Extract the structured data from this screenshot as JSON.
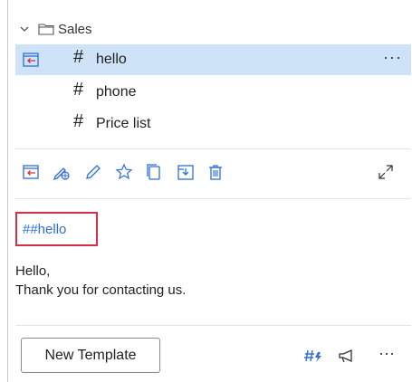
{
  "folder": {
    "name": "Sales"
  },
  "templates": [
    {
      "hash": "#",
      "label": "hello"
    },
    {
      "hash": "#",
      "label": "phone"
    },
    {
      "hash": "#",
      "label": "Price list"
    }
  ],
  "selected_more": "···",
  "preview": {
    "name": "##hello",
    "body": [
      "Hello,",
      "Thank you for contacting us."
    ]
  },
  "footer": {
    "new_template_label": "New Template",
    "more": "···"
  },
  "colors": {
    "accent": "#2e6fd6",
    "selection": "#cfe3f8",
    "highlight_border": "#d32f4a"
  }
}
